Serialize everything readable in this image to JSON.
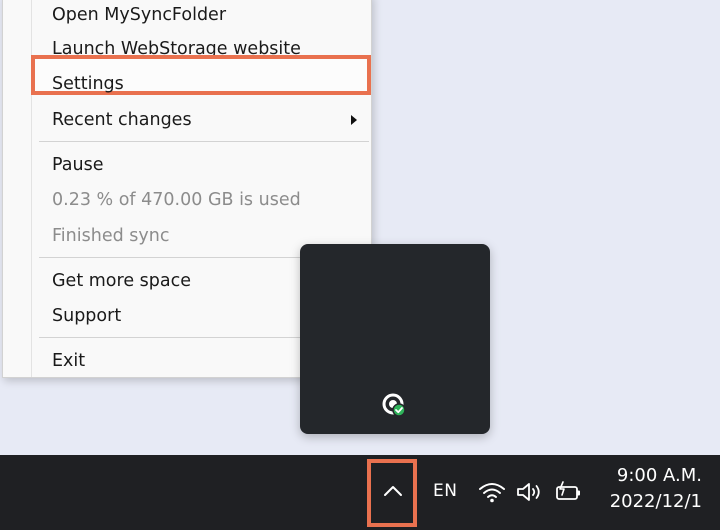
{
  "context_menu": {
    "items": [
      {
        "label": "Open MySyncFolder",
        "disabled": false
      },
      {
        "label": "Launch WebStorage website",
        "disabled": false
      },
      {
        "label": "Settings",
        "disabled": false,
        "highlighted": true
      },
      {
        "label": "Recent changes",
        "disabled": false,
        "submenu": true
      },
      {
        "label": "Pause",
        "disabled": false
      },
      {
        "label": "0.23 % of 470.00 GB is used",
        "disabled": true
      },
      {
        "label": "Finished sync",
        "disabled": true
      },
      {
        "label": "Get more space",
        "disabled": false
      },
      {
        "label": "Support",
        "disabled": false,
        "submenu": true
      },
      {
        "label": "Exit",
        "disabled": false
      }
    ]
  },
  "taskbar": {
    "language": "EN",
    "time": "9:00 A.M.",
    "date": "2022/12/1",
    "icons": [
      "show-hidden-icons-chevron",
      "wifi-icon",
      "volume-icon",
      "battery-icon"
    ]
  },
  "tray_flyout": {
    "icons": [
      "sync-app-icon"
    ]
  },
  "colors": {
    "highlight_border": "#e9714f",
    "taskbar_bg": "#1f2023",
    "flyout_bg": "#24272b",
    "menu_bg": "#f9f9f9",
    "disabled_text": "#8c8c8c"
  }
}
